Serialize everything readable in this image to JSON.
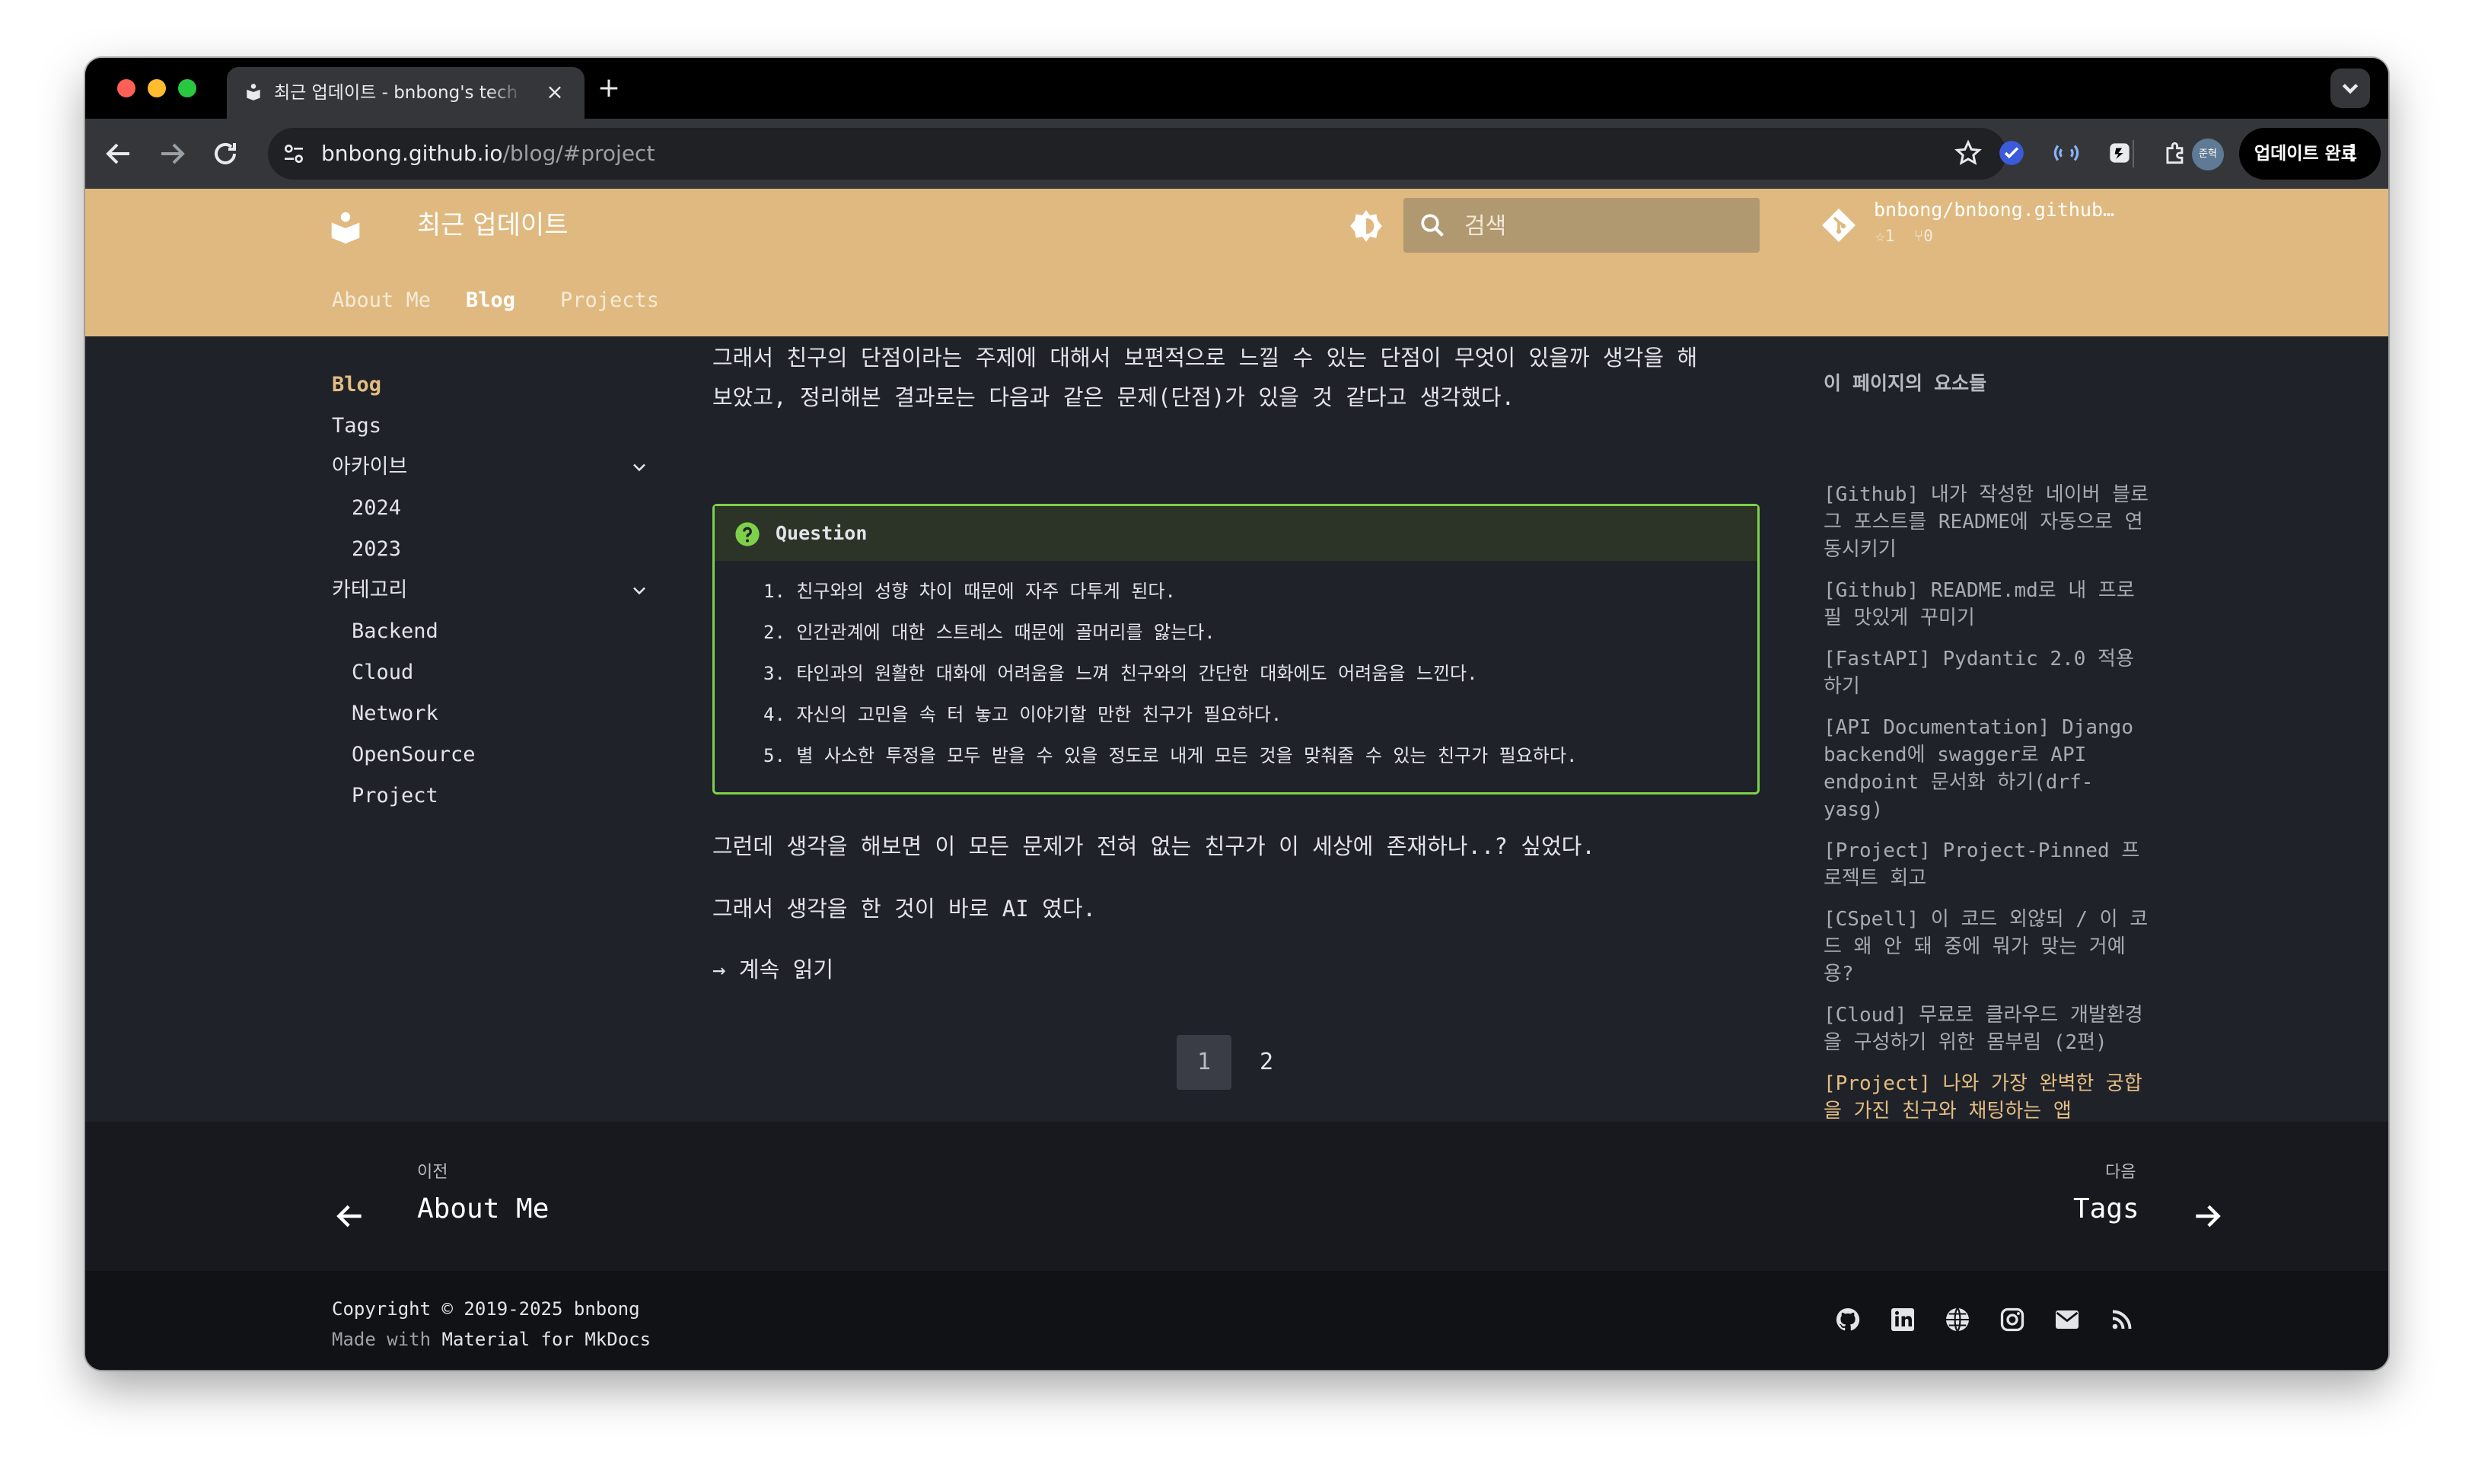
{
  "browser": {
    "tab_title": "최근 업데이트 - bnbong's tech blog",
    "url_host": "bnbong.github.io",
    "url_path": "/blog/#project",
    "profile_label": "준혁",
    "update_label": "업데이트 완료"
  },
  "site": {
    "title": "최근 업데이트",
    "search_placeholder": "검색",
    "repo_name": "bnbong/bnbong.github.io",
    "repo_stars": "☆1",
    "repo_forks": "⑂0",
    "tabs": [
      "About Me",
      "Blog",
      "Projects"
    ]
  },
  "nav": {
    "blog": "Blog",
    "tags": "Tags",
    "archive": "아카이브",
    "archive_items": [
      "2024",
      "2023"
    ],
    "category": "카테고리",
    "category_items": [
      "Backend",
      "Cloud",
      "Network",
      "OpenSource",
      "Project"
    ]
  },
  "content": {
    "para1_line1": "그래서 친구의 단점이라는 주제에 대해서 보편적으로 느낄 수 있는 단점이 무엇이 있을까 생각을 해",
    "para1_line2": "보았고, 정리해본 결과로는 다음과 같은 문제(단점)가 있을 것 같다고 생각했다.",
    "admonition_title": "Question",
    "questions": [
      "1. 친구와의 성향 차이 때문에 자주 다투게 된다.",
      "2. 인간관계에 대한 스트레스 때문에 골머리를 앓는다.",
      "3. 타인과의 원활한 대화에 어려움을 느껴 친구와의 간단한 대화에도 어려움을 느낀다.",
      "4. 자신의 고민을 속 터 놓고 이야기할 만한 친구가 필요하다.",
      "5. 별 사소한 투정을 모두 받을 수 있을 정도로 내게 모든 것을 맞춰줄 수 있는 친구가 필요하다."
    ],
    "para2": "그런데 생각을 해보면 이 모든 문제가 전혀 없는 친구가 이 세상에 존재하나..? 싶었다.",
    "para3": "그래서 생각을 한 것이 바로 AI 였다.",
    "read_more": "→ 계속 읽기",
    "pages": [
      "1",
      "2"
    ]
  },
  "toc": {
    "title": "이 페이지의 요소들",
    "items": [
      "[Github] 내가 작성한 네이버 블로그 포스트를 README에 자동으로 연동시키기",
      "[Github] README.md로 내 프로필 맛있게 꾸미기",
      "[FastAPI] Pydantic 2.0 적용하기",
      "[API Documentation] Django backend에 swagger로 API endpoint 문서화 하기(drf-yasg)",
      "[Project] Project-Pinned 프로젝트 회고",
      "[CSpell] 이 코드 외않되 / 이 코드 왜 안 돼 중에 뭐가 맞는 거예용?",
      "[Cloud] 무료로 클라우드 개발환경을 구성하기 위한 몸부림 (2편)",
      "[Project] 나와 가장 완벽한 궁합을 가진 친구와 채팅하는 앱"
    ]
  },
  "footer": {
    "prev_label": "이전",
    "prev_title": "About Me",
    "next_label": "다음",
    "next_title": "Tags",
    "copyright": "Copyright © 2019-2025 bnbong",
    "made_with": "Made with",
    "made_with_link": "Material for MkDocs"
  },
  "colors": {
    "header": "#dfb97f",
    "accent": "#e4bd83",
    "admonition_border": "#7ed04b",
    "page_bg": "#1f2228"
  }
}
